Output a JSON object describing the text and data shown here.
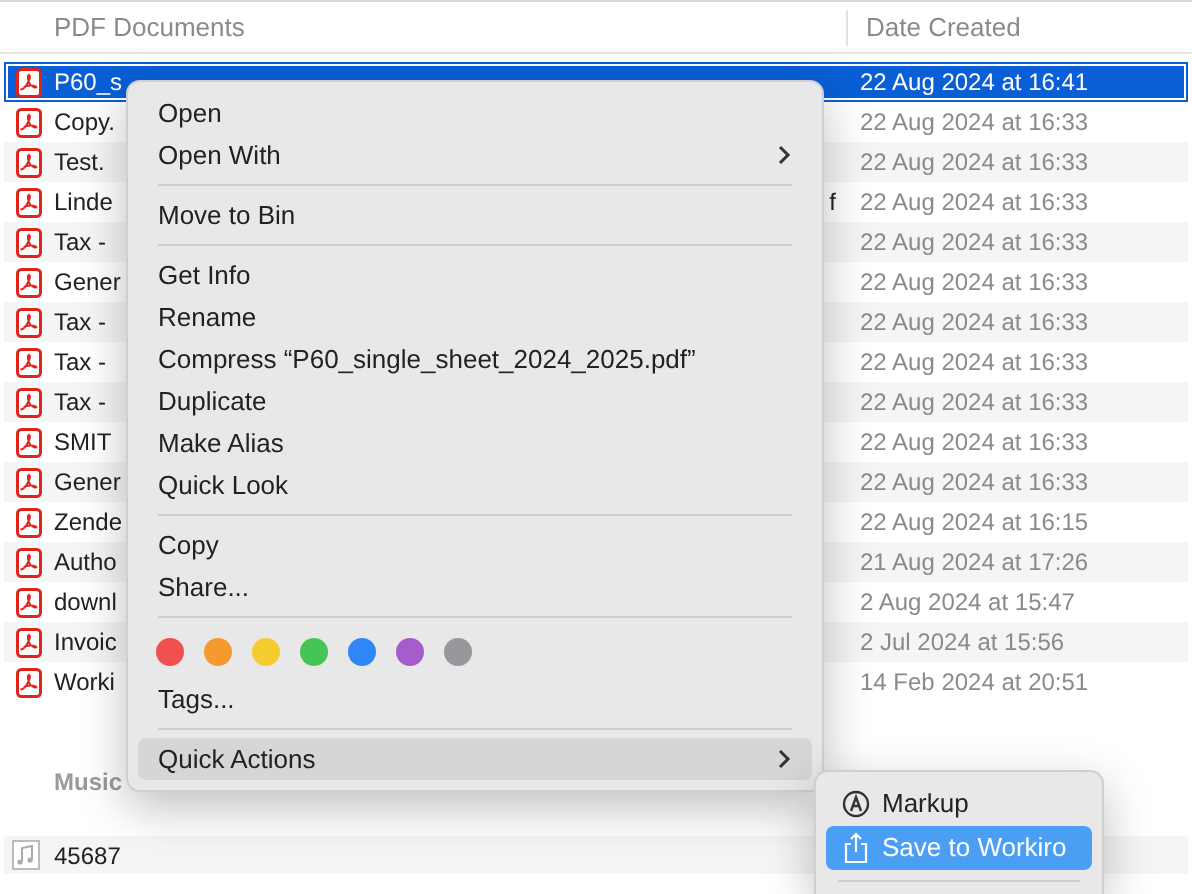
{
  "columns": [
    {
      "label": "PDF Documents"
    },
    {
      "label": "Date Created"
    }
  ],
  "rows": [
    {
      "name": "P60_s",
      "date": "22 Aug 2024 at 16:41",
      "selected": true
    },
    {
      "name": "Copy.",
      "date": "22 Aug 2024 at 16:33",
      "selected": false
    },
    {
      "name": "Test.",
      "date": "22 Aug 2024 at 16:33",
      "selected": false
    },
    {
      "name": "Linde",
      "name_tail": "f",
      "date": "22 Aug 2024 at 16:33",
      "selected": false
    },
    {
      "name": "Tax -",
      "date": "22 Aug 2024 at 16:33",
      "selected": false
    },
    {
      "name": "Gener",
      "date": "22 Aug 2024 at 16:33",
      "selected": false
    },
    {
      "name": "Tax -",
      "date": "22 Aug 2024 at 16:33",
      "selected": false
    },
    {
      "name": "Tax -",
      "date": "22 Aug 2024 at 16:33",
      "selected": false
    },
    {
      "name": "Tax -",
      "date": "22 Aug 2024 at 16:33",
      "selected": false
    },
    {
      "name": "SMIT",
      "date": "22 Aug 2024 at 16:33",
      "selected": false
    },
    {
      "name": "Gener",
      "date": "22 Aug 2024 at 16:33",
      "selected": false
    },
    {
      "name": "Zende",
      "date": "22 Aug 2024 at 16:15",
      "selected": false
    },
    {
      "name": "Autho",
      "date": "21 Aug 2024 at 17:26",
      "selected": false
    },
    {
      "name": "downl",
      "date": "2 Aug 2024 at 15:47",
      "selected": false
    },
    {
      "name": "Invoic",
      "date": "2 Jul 2024 at 15:56",
      "selected": false
    },
    {
      "name": "Worki",
      "date": "14 Feb 2024 at 20:51",
      "selected": false
    }
  ],
  "music_group": {
    "label": "Music",
    "rows": [
      {
        "name": "45687"
      }
    ]
  },
  "context_menu": {
    "items": [
      {
        "kind": "item",
        "label": "Open",
        "submenu": false,
        "selected": false
      },
      {
        "kind": "item",
        "label": "Open With",
        "submenu": true,
        "selected": false
      },
      {
        "kind": "separator"
      },
      {
        "kind": "item",
        "label": "Move to Bin",
        "submenu": false,
        "selected": false
      },
      {
        "kind": "separator"
      },
      {
        "kind": "item",
        "label": "Get Info",
        "submenu": false,
        "selected": false
      },
      {
        "kind": "item",
        "label": "Rename",
        "submenu": false,
        "selected": false
      },
      {
        "kind": "item",
        "label": "Compress “P60_single_sheet_2024_2025.pdf”",
        "submenu": false,
        "selected": false
      },
      {
        "kind": "item",
        "label": "Duplicate",
        "submenu": false,
        "selected": false
      },
      {
        "kind": "item",
        "label": "Make Alias",
        "submenu": false,
        "selected": false
      },
      {
        "kind": "item",
        "label": "Quick Look",
        "submenu": false,
        "selected": false
      },
      {
        "kind": "separator"
      },
      {
        "kind": "item",
        "label": "Copy",
        "submenu": false,
        "selected": false
      },
      {
        "kind": "item",
        "label": "Share...",
        "submenu": false,
        "selected": false
      },
      {
        "kind": "separator"
      },
      {
        "kind": "tags",
        "colors": [
          {
            "color": "#f0504f"
          },
          {
            "color": "#f49a30"
          },
          {
            "color": "#f5cc30"
          },
          {
            "color": "#46c556"
          },
          {
            "color": "#2f86f5"
          },
          {
            "color": "#a65ccb"
          },
          {
            "color": "#98989c"
          }
        ]
      },
      {
        "kind": "item",
        "label": "Tags...",
        "submenu": false,
        "selected": false
      },
      {
        "kind": "separator"
      },
      {
        "kind": "item",
        "label": "Quick Actions",
        "submenu": true,
        "selected": true
      }
    ]
  },
  "submenu": {
    "items": [
      {
        "label": "Markup",
        "kind": "markup",
        "selected": false
      },
      {
        "label": "Save to Workiro",
        "kind": "share",
        "selected": true
      }
    ]
  }
}
